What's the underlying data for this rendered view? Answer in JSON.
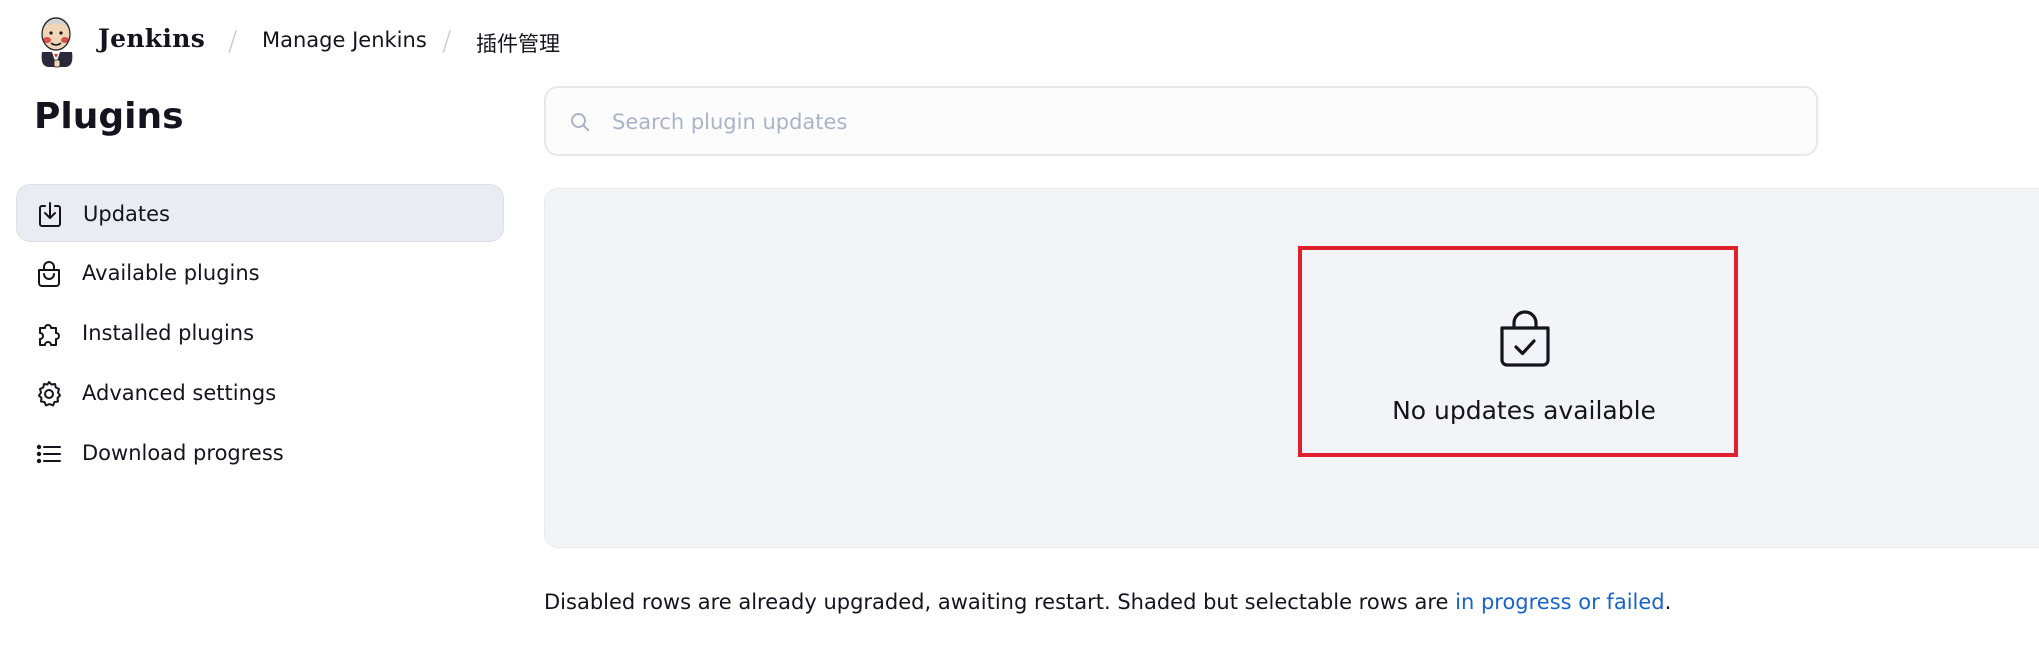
{
  "header": {
    "brand": "Jenkins",
    "breadcrumbs": [
      {
        "label": "Manage Jenkins"
      },
      {
        "label": "插件管理"
      }
    ],
    "separator": "/"
  },
  "page": {
    "title": "Plugins"
  },
  "sidebar": {
    "items": [
      {
        "label": "Updates",
        "icon": "download-tray-icon",
        "active": true
      },
      {
        "label": "Available plugins",
        "icon": "shopping-bag-icon",
        "active": false
      },
      {
        "label": "Installed plugins",
        "icon": "puzzle-piece-icon",
        "active": false
      },
      {
        "label": "Advanced settings",
        "icon": "gear-icon",
        "active": false
      },
      {
        "label": "Download progress",
        "icon": "list-icon",
        "active": false
      }
    ]
  },
  "search": {
    "placeholder": "Search plugin updates",
    "value": ""
  },
  "empty_state": {
    "icon": "bag-check-icon",
    "message": "No updates available"
  },
  "footer_note": {
    "text_before": "Disabled rows are already upgraded, awaiting restart. Shaded but selectable rows are ",
    "link_text": "in progress or failed",
    "text_after": "."
  },
  "colors": {
    "accent_link": "#1863c9",
    "highlight_border": "#e0212d",
    "active_nav_bg": "#e9edf3",
    "panel_bg": "#f2f4f7"
  }
}
